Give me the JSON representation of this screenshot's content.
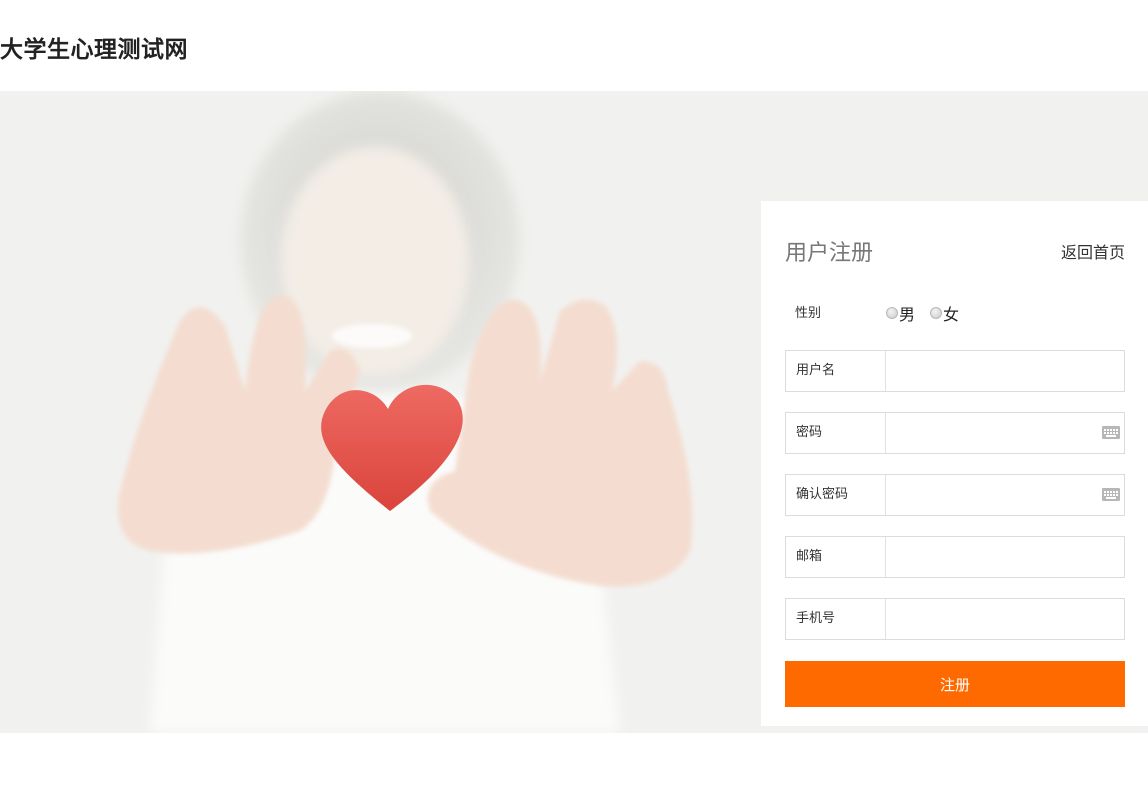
{
  "header": {
    "site_title": "大学生心理测试网"
  },
  "register": {
    "title": "用户注册",
    "back_link": "返回首页",
    "gender": {
      "label": "性别",
      "options": [
        "男",
        "女"
      ]
    },
    "fields": [
      {
        "label": "用户名",
        "value": ""
      },
      {
        "label": "密码",
        "value": ""
      },
      {
        "label": "确认密码",
        "value": ""
      },
      {
        "label": "邮箱",
        "value": ""
      },
      {
        "label": "手机号",
        "value": ""
      }
    ],
    "submit_label": "注册"
  },
  "colors": {
    "accent": "#ff6a00",
    "hero_bg": "#f1f1ef",
    "heart": "#e8534a"
  },
  "icons": {
    "password_fields": "keyboard-icon"
  }
}
